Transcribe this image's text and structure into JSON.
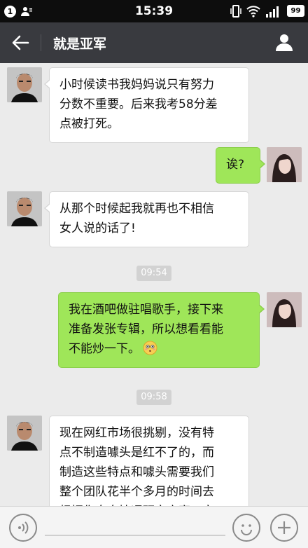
{
  "status_bar": {
    "time": "15:39",
    "notification_count": "1",
    "battery": "99"
  },
  "header": {
    "title": "就是亚军",
    "back_icon": "arrow-left-icon",
    "profile_icon": "person-icon"
  },
  "messages": [
    {
      "side": "left",
      "text": "小时候读书我妈妈说只有努力\n分数不重要。后来我考58分差\n点被打死。"
    },
    {
      "side": "right",
      "text": "诶?"
    },
    {
      "side": "left",
      "text": "从那个时候起我就再也不相信\n女人说的话了!"
    },
    {
      "time": "09:54"
    },
    {
      "side": "right",
      "text": "我在酒吧做驻唱歌手，接下来\n准备发张专辑，所以想看看能\n不能炒一下。",
      "emoji": "flushed-face"
    },
    {
      "time": "09:58"
    },
    {
      "side": "left",
      "text": "现在网红市场很挑剔，没有特\n点不制造噱头是红不了的，而\n制造这些特点和噱头需要我们\n整个团队花半个多月的时间去\n根据你自身情况研究方案，完"
    }
  ],
  "colors": {
    "status_bg": "#0d0d0d",
    "titlebar_bg": "#393a3f",
    "chat_bg": "#ebebeb",
    "bubble_self": "#9fe659",
    "bubble_other": "#ffffff",
    "time_chip": "#d2d2d2"
  }
}
